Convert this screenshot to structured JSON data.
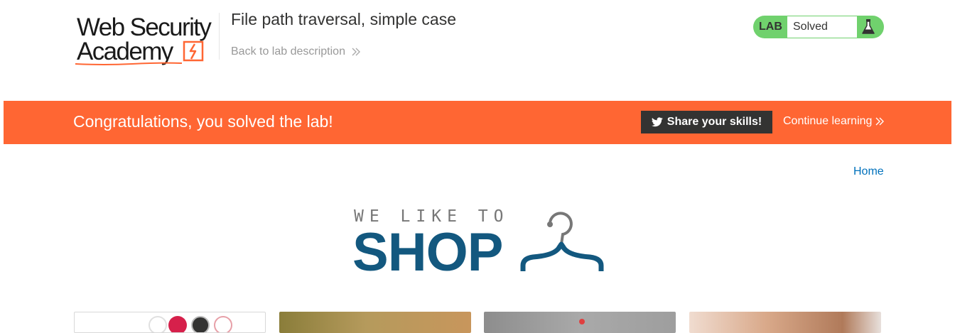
{
  "header": {
    "logo_line1": "Web Security",
    "logo_line2": "Academy",
    "lab_title": "File path traversal, simple case",
    "back_link": "Back to lab description",
    "lab_tag": "LAB",
    "lab_status": "Solved"
  },
  "banner": {
    "message": "Congratulations, you solved the lab!",
    "share_label": "Share your skills!",
    "continue_label": "Continue learning"
  },
  "nav": {
    "home": "Home"
  },
  "shop_logo": {
    "tagline": "WE LIKE TO",
    "word": "SHOP"
  },
  "colors": {
    "banner": "#ff6633",
    "lab_status_bg": "#70d16d",
    "brand_orange": "#ff6633",
    "shop_blue": "#13587f",
    "link_blue": "#0071bc"
  },
  "icons": {
    "back_chevron": "double-chevron-right-icon",
    "continue_chevron": "double-chevron-right-icon",
    "share": "twitter-bird-icon",
    "lab_status": "flask-icon",
    "shop_logo": "hanger-icon"
  }
}
